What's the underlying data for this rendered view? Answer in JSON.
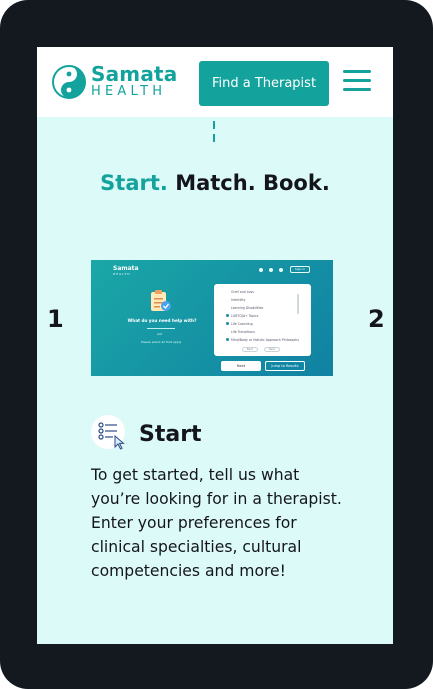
{
  "brand": {
    "name_top": "Samata",
    "name_bottom": "HEALTH"
  },
  "header": {
    "find_therapist_label": "Find a Therapist"
  },
  "hero": {
    "headline_accent": "Start.",
    "headline_rest": " Match. Book."
  },
  "carousel": {
    "left_number": "1",
    "right_number": "2"
  },
  "mini_screenshot": {
    "logo_top": "Samata",
    "logo_bottom": "HEALTH",
    "signin_label": "Sign in",
    "question": "What do you need help with?",
    "count": "1/4",
    "select_hint": "Please select all that apply",
    "options": [
      "Grief and Loss",
      "Infertility",
      "Learning Disabilities",
      "LGBTQIA+ Topics",
      "Life Coaching",
      "Life Transitions",
      "Mind/Body or Holistic Approach Philosophy"
    ],
    "pill_1": "Back",
    "pill_2": "Next",
    "next_label": "Next",
    "jump_label": "Jump to Results"
  },
  "start_section": {
    "title": "Start",
    "description": "To get started, tell us what you’re looking for in a therapist. Enter your preferences for clinical specialties, cultural competencies and more!"
  },
  "colors": {
    "brand": "#14a39c",
    "background": "#dcfaf8",
    "text": "#14161c",
    "frame": "#14181f"
  },
  "icons": [
    "yin-yang-logo-icon",
    "hamburger-menu-icon",
    "clipboard-icon",
    "checklist-cursor-icon"
  ]
}
